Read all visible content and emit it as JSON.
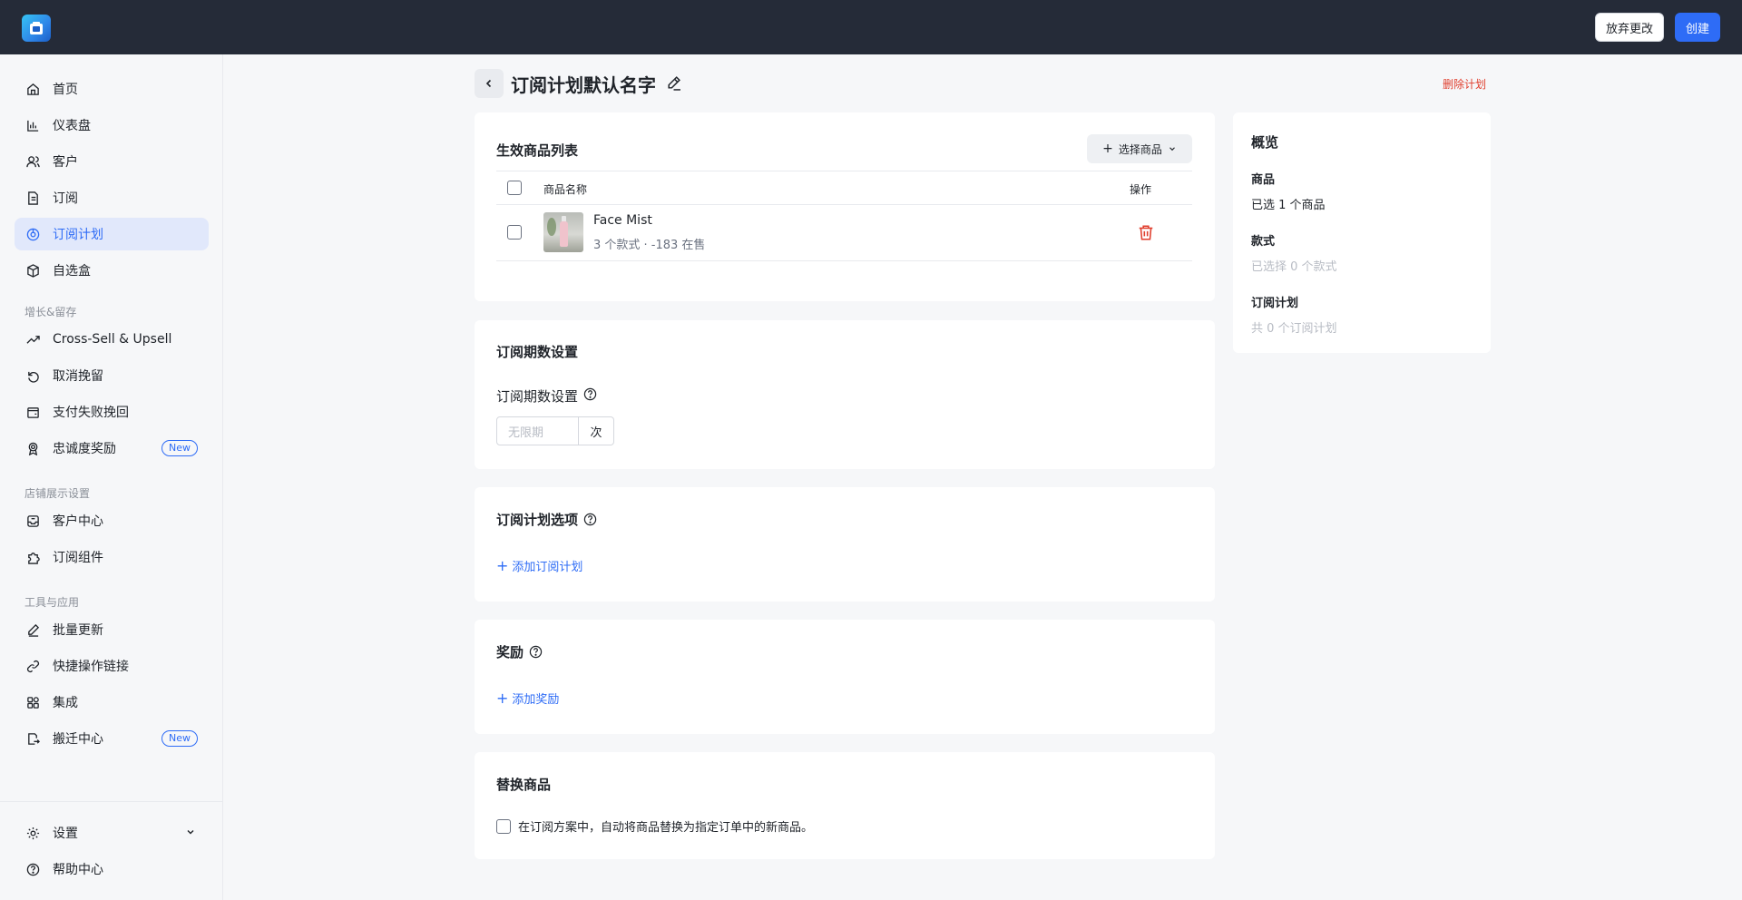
{
  "topbar": {
    "discard_label": "放弃更改",
    "create_label": "创建"
  },
  "sidebar": {
    "items_main": [
      {
        "label": "首页",
        "icon": "home-icon"
      },
      {
        "label": "仪表盘",
        "icon": "bar-chart-icon"
      },
      {
        "label": "客户",
        "icon": "users-icon"
      },
      {
        "label": "订阅",
        "icon": "document-icon"
      },
      {
        "label": "订阅计划",
        "icon": "plan-icon",
        "active": true
      },
      {
        "label": "自选盒",
        "icon": "box-icon"
      }
    ],
    "section_growth": "增长&留存",
    "items_growth": [
      {
        "label": "Cross-Sell & Upsell",
        "icon": "trend-up-icon"
      },
      {
        "label": "取消挽留",
        "icon": "undo-icon"
      },
      {
        "label": "支付失败挽回",
        "icon": "wallet-icon"
      },
      {
        "label": "忠诚度奖励",
        "icon": "award-icon",
        "badge": "New"
      }
    ],
    "section_store": "店铺展示设置",
    "items_store": [
      {
        "label": "客户中心",
        "icon": "inbox-icon"
      },
      {
        "label": "订阅组件",
        "icon": "puzzle-icon"
      }
    ],
    "section_tools": "工具与应用",
    "items_tools": [
      {
        "label": "批量更新",
        "icon": "pencil-icon"
      },
      {
        "label": "快捷操作链接",
        "icon": "link-icon"
      },
      {
        "label": "集成",
        "icon": "grid-icon"
      },
      {
        "label": "搬迁中心",
        "icon": "migrate-icon",
        "badge": "New"
      }
    ],
    "settings_label": "设置",
    "help_label": "帮助中心"
  },
  "page": {
    "title": "订阅计划默认名字",
    "delete_label": "删除计划"
  },
  "products": {
    "title": "生效商品列表",
    "select_label": "选择商品",
    "col_name": "商品名称",
    "col_action": "操作",
    "rows": [
      {
        "name": "Face Mist",
        "sub": "3 个款式 · -183 在售"
      }
    ]
  },
  "periods": {
    "title": "订阅期数设置",
    "field_label": "订阅期数设置",
    "placeholder": "无限期",
    "unit": "次"
  },
  "options": {
    "title": "订阅计划选项",
    "add_label": "添加订阅计划"
  },
  "rewards": {
    "title": "奖励",
    "add_label": "添加奖励"
  },
  "replace": {
    "title": "替换商品",
    "checkbox_label": "在订阅方案中，自动将商品替换为指定订单中的新商品。"
  },
  "overview": {
    "title": "概览",
    "product_label": "商品",
    "product_value": "已选 1 个商品",
    "variant_label": "款式",
    "variant_value": "已选择 0 个款式",
    "plan_label": "订阅计划",
    "plan_value": "共 0 个订阅计划"
  },
  "colors": {
    "accent": "#2e6cf6",
    "topbar": "#252b38",
    "danger": "#e03e2d"
  }
}
